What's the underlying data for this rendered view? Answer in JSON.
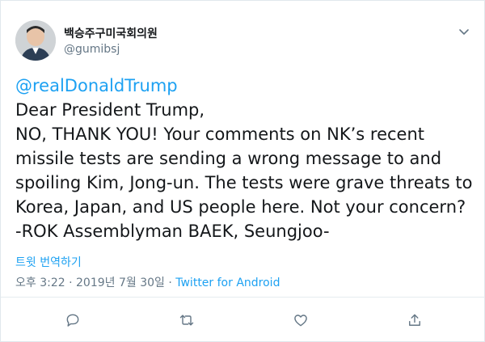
{
  "author": {
    "display_name": "백승주구미국회의원",
    "handle": "@gumibsj",
    "avatar_icon": "person-avatar-icon"
  },
  "tweet": {
    "mention": "@realDonaldTrump",
    "text": "Dear President Trump,\nNO, THANK YOU! Your comments on NK’s recent\nmissile tests are sending a wrong message to and\nspoiling Kim, Jong-un. The tests were grave threats to\nKorea, Japan, and US people here. Not your concern?\n-ROK Assemblyman BAEK, Seungjoo-"
  },
  "translate_label": "트윗 번역하기",
  "meta": {
    "timestamp": "오후 3:22 · 2019년 7월 30일 · ",
    "source": "Twitter for Android"
  },
  "actions": {
    "reply_icon": "reply-icon",
    "retweet_icon": "retweet-icon",
    "like_icon": "heart-icon",
    "share_icon": "share-icon"
  },
  "colors": {
    "link": "#1da1f2",
    "text": "#14171a",
    "muted": "#657786"
  }
}
